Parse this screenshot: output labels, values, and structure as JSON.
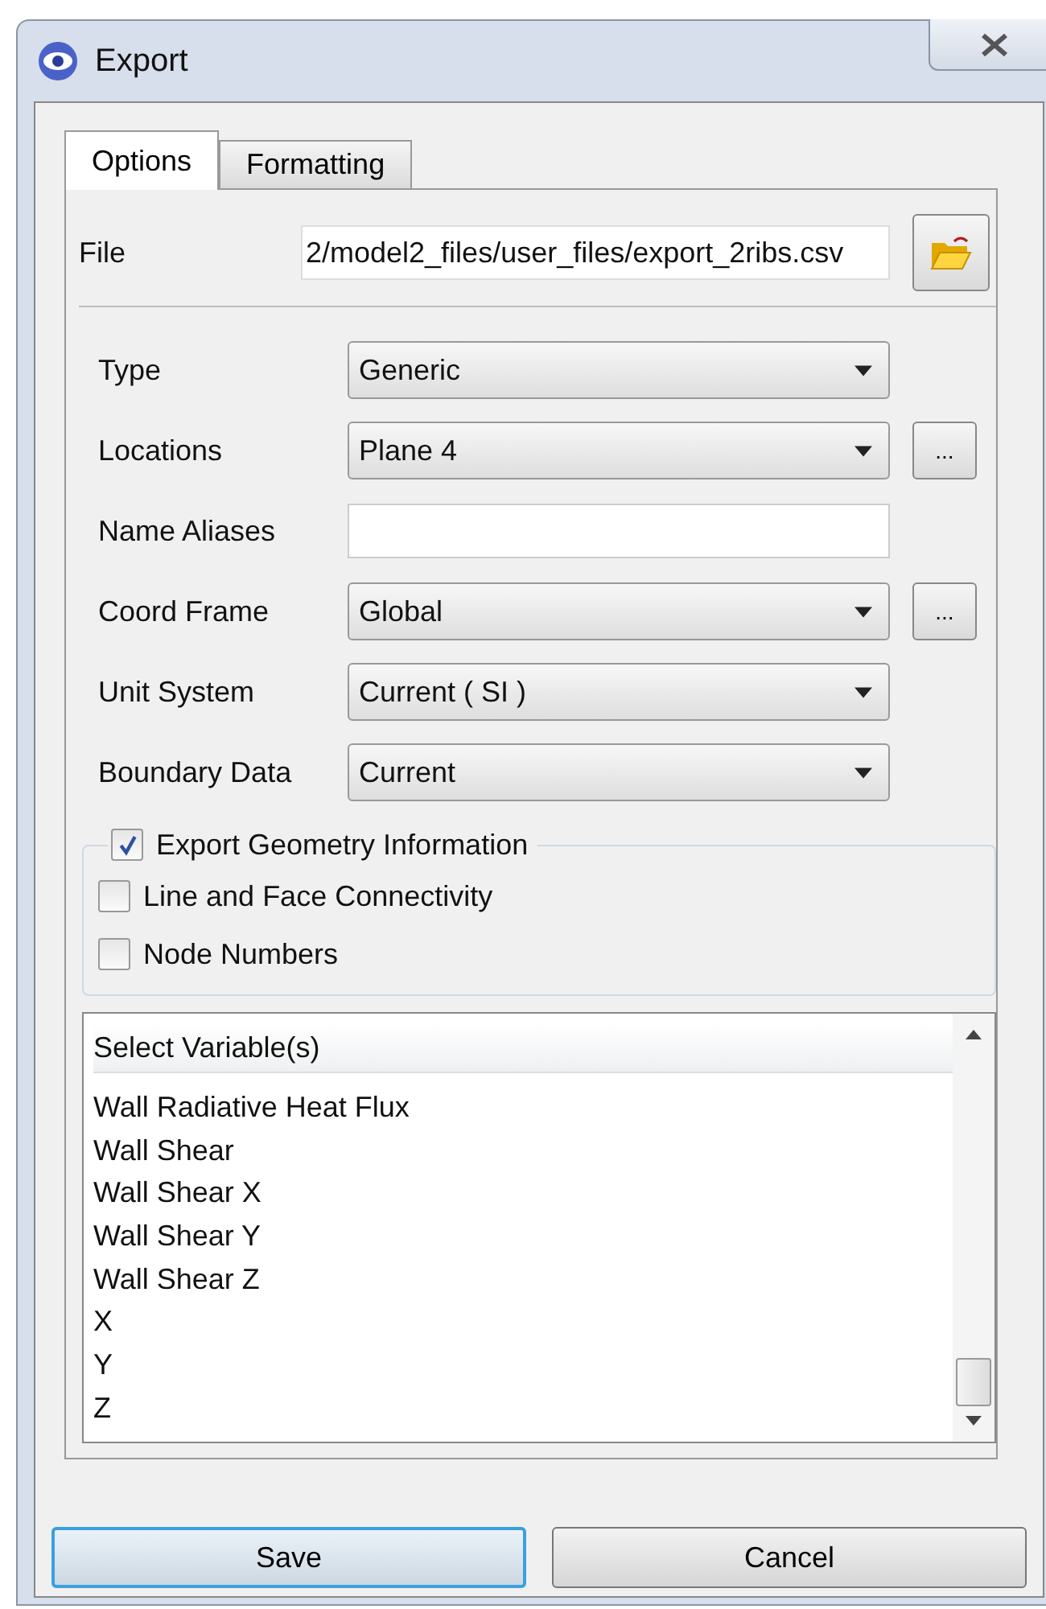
{
  "window": {
    "title": "Export"
  },
  "tabs": [
    {
      "label": "Options",
      "selected": true
    },
    {
      "label": "Formatting",
      "selected": false
    }
  ],
  "file": {
    "label": "File",
    "value": "2/model2_files/user_files/export_2ribs.csv"
  },
  "fields": [
    {
      "label": "Type",
      "kind": "dropdown",
      "value": "Generic",
      "more_button": false
    },
    {
      "label": "Locations",
      "kind": "dropdown",
      "value": "Plane 4",
      "more_button": true,
      "more_label": "..."
    },
    {
      "label": "Name Aliases",
      "kind": "text",
      "more_button": false
    },
    {
      "label": "Coord Frame",
      "kind": "dropdown",
      "value": "Global",
      "more_button": true,
      "more_label": "..."
    },
    {
      "label": "Unit System",
      "kind": "dropdown",
      "value": "Current ( SI )",
      "more_button": false
    },
    {
      "label": "Boundary Data",
      "kind": "dropdown",
      "value": "Current",
      "more_button": false
    }
  ],
  "geometry_group": {
    "label": "Export Geometry Information",
    "checked": true,
    "options": [
      {
        "label": "Line and Face Connectivity",
        "checked": false
      },
      {
        "label": "Node Numbers",
        "checked": false
      }
    ]
  },
  "variables": {
    "header": "Select Variable(s)",
    "items": [
      "Wall Radiative Heat Flux",
      "Wall Shear",
      "Wall Shear X",
      "Wall Shear Y",
      "Wall Shear Z",
      "X",
      "Y",
      "Z"
    ]
  },
  "buttons": [
    {
      "label": "Save",
      "selected": true
    },
    {
      "label": "Cancel",
      "selected": false
    }
  ]
}
